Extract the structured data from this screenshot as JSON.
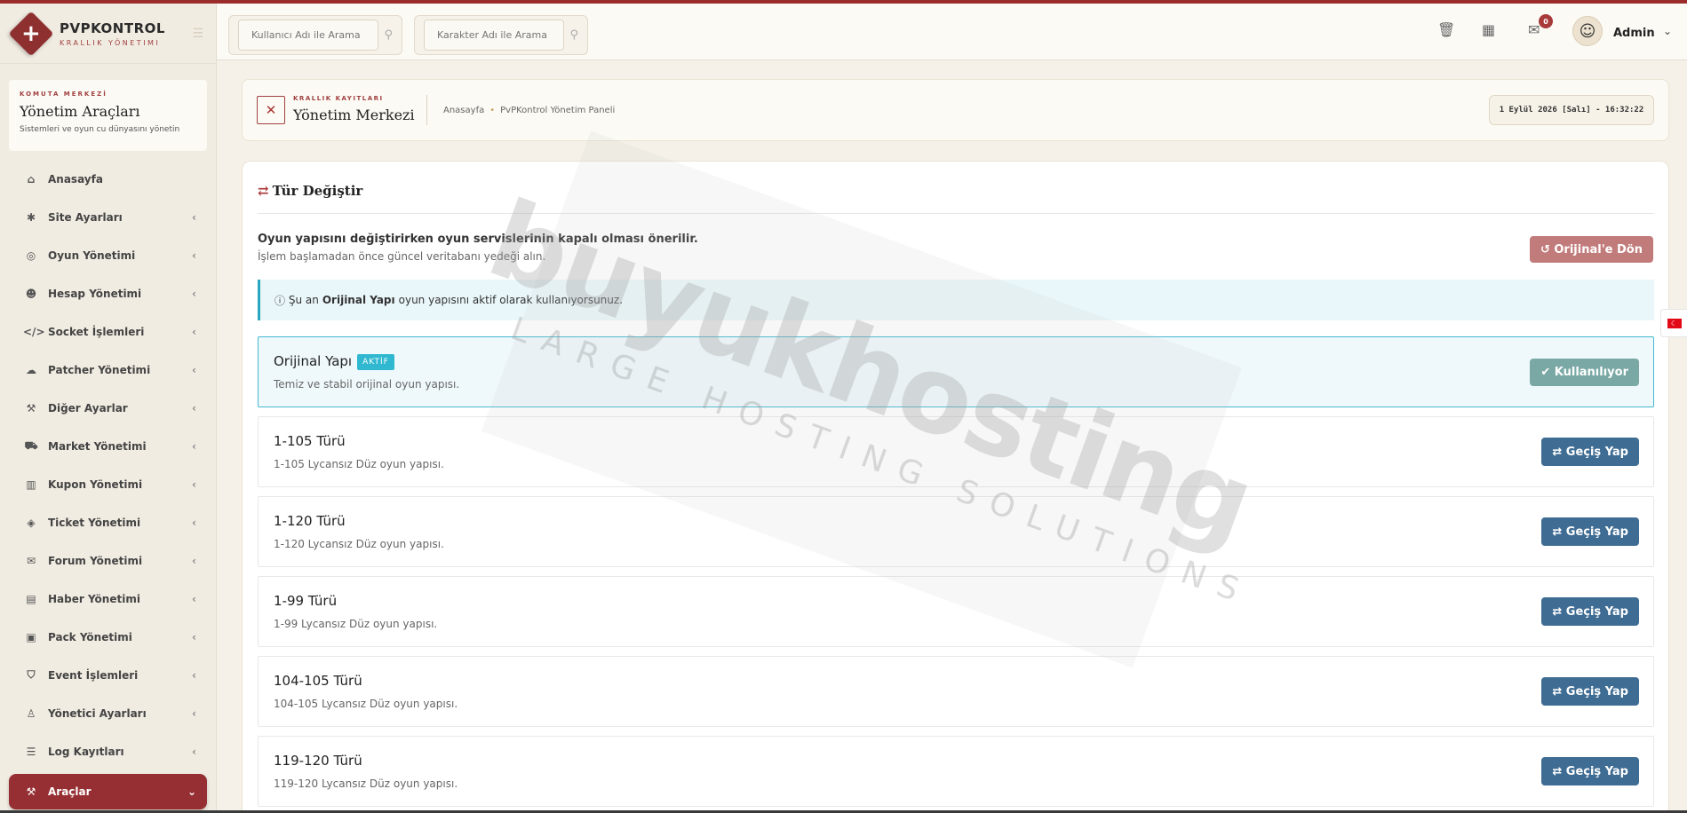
{
  "brand": {
    "name": "PVPKONTROL",
    "sub": "KRALLIK YÖNETIMI"
  },
  "sidebar": {
    "card_tag": "KOMUTA MERKEZİ",
    "card_title": "Yönetim Araçları",
    "card_sub": "Sistemleri ve oyun cu dünyasını yönetin",
    "items": [
      {
        "label": "Anasayfa",
        "icon": "home-icon",
        "glyph": "⌂"
      },
      {
        "label": "Site Ayarları",
        "icon": "gear-icon",
        "glyph": "✱"
      },
      {
        "label": "Oyun Yönetimi",
        "icon": "gamepad-icon",
        "glyph": "◎"
      },
      {
        "label": "Hesap Yönetimi",
        "icon": "users-icon",
        "glyph": "☻"
      },
      {
        "label": "Socket İşlemleri",
        "icon": "code-icon",
        "glyph": "</>"
      },
      {
        "label": "Patcher Yönetimi",
        "icon": "cloud-upload-icon",
        "glyph": "☁"
      },
      {
        "label": "Diğer Ayarlar",
        "icon": "wrench-icon",
        "glyph": "⚒"
      },
      {
        "label": "Market Yönetimi",
        "icon": "cart-icon",
        "glyph": "⛟"
      },
      {
        "label": "Kupon Yönetimi",
        "icon": "barcode-icon",
        "glyph": "▥"
      },
      {
        "label": "Ticket Yönetimi",
        "icon": "ticket-icon",
        "glyph": "◈"
      },
      {
        "label": "Forum Yönetimi",
        "icon": "comments-icon",
        "glyph": "✉"
      },
      {
        "label": "Haber Yönetimi",
        "icon": "newspaper-icon",
        "glyph": "▤"
      },
      {
        "label": "Pack Yönetimi",
        "icon": "pack-icon",
        "glyph": "▣"
      },
      {
        "label": "Event İşlemleri",
        "icon": "shield-icon",
        "glyph": "⛉"
      },
      {
        "label": "Yönetici Ayarları",
        "icon": "user-tie-icon",
        "glyph": "♙"
      },
      {
        "label": "Log Kayıtları",
        "icon": "list-icon",
        "glyph": "☰"
      }
    ],
    "active_item": {
      "label": "Araçlar",
      "icon": "tools-icon",
      "glyph": "⚒"
    }
  },
  "header": {
    "search_user_placeholder": "Kullanıcı Adı ile Arama",
    "search_char_placeholder": "Karakter Adı ile Arama",
    "notification_count": "0",
    "admin_name": "Admin"
  },
  "titlebar": {
    "tag": "KRALLIK KAYITLARI",
    "title": "Yönetim Merkezi",
    "crumb_home": "Anasayfa",
    "crumb_current": "PvPKontrol Yönetim Paneli",
    "datetime": "1 Eylül 2026 [Salı] - 16:32:22"
  },
  "main": {
    "title": "Tür Değiştir",
    "warning_bold": "Oyun yapısını değiştirirken oyun servislerinin kapalı olması önerilir.",
    "warning_sub": "İşlem başlamadan önce güncel veritabanı yedeği alın.",
    "revert_label": "Orijinal'e Dön",
    "info_prefix": "Şu an",
    "info_bold": "Orijinal Yapı",
    "info_suffix": "oyun yapısını aktif olarak kullanıyorsunuz.",
    "options": [
      {
        "name": "Orijinal Yapı",
        "desc": "Temiz ve stabil orijinal oyun yapısı.",
        "badge": "AKTİF",
        "button": "Kullanılıyor",
        "active": true
      },
      {
        "name": "1-105 Türü",
        "desc": "1-105 Lycansız Düz oyun yapısı.",
        "button": "Geçiş Yap",
        "active": false
      },
      {
        "name": "1-120 Türü",
        "desc": "1-120 Lycansız Düz oyun yapısı.",
        "button": "Geçiş Yap",
        "active": false
      },
      {
        "name": "1-99 Türü",
        "desc": "1-99 Lycansız Düz oyun yapısı.",
        "button": "Geçiş Yap",
        "active": false
      },
      {
        "name": "104-105 Türü",
        "desc": "104-105 Lycansız Düz oyun yapısı.",
        "button": "Geçiş Yap",
        "active": false
      },
      {
        "name": "119-120 Türü",
        "desc": "119-120 Lycansız Düz oyun yapısı.",
        "button": "Geçiş Yap",
        "active": false
      }
    ]
  },
  "watermark": {
    "main": "buyukhosting",
    "sub": "LARGE HOSTING SOLUTIONS"
  },
  "colors": {
    "accent": "#962f33",
    "switch_button": "#3f6c93",
    "info": "#2aa7c0",
    "used_button": "#7aa8a4"
  }
}
